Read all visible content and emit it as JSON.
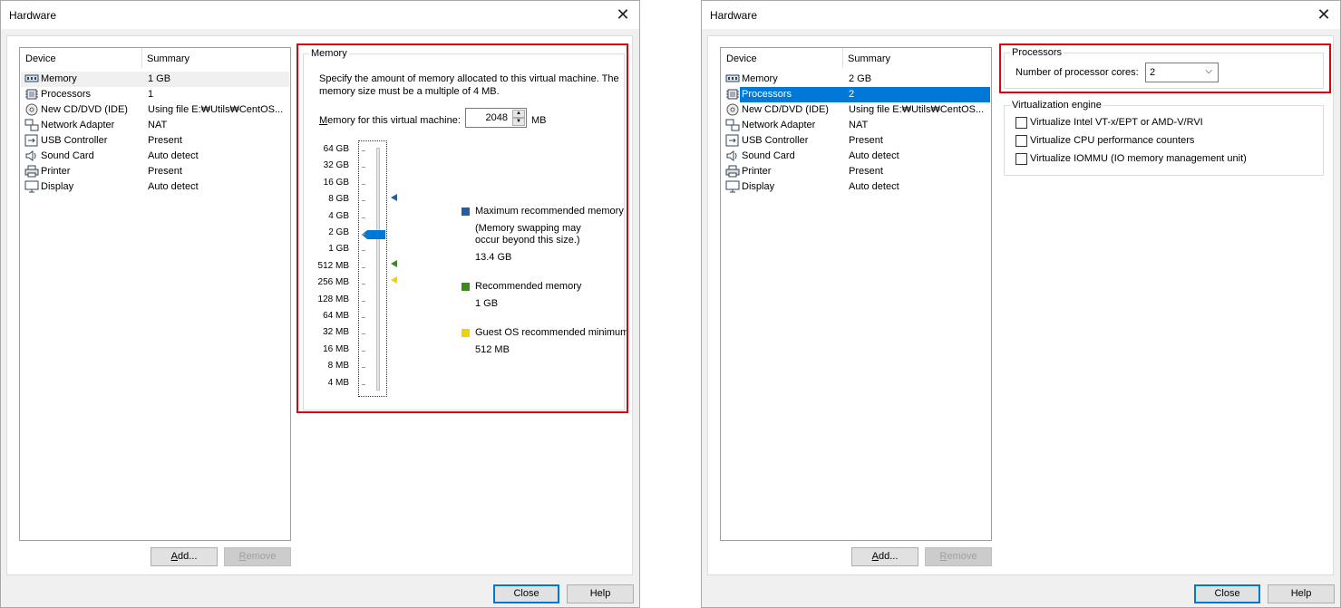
{
  "left": {
    "title": "Hardware",
    "list_headers": {
      "device": "Device",
      "summary": "Summary"
    },
    "devices": [
      {
        "name": "Memory",
        "summary": "1 GB",
        "icon": "memory-icon"
      },
      {
        "name": "Processors",
        "summary": "1",
        "icon": "processor-icon"
      },
      {
        "name": "New CD/DVD (IDE)",
        "summary": "Using file E:₩Utils₩CentOS...",
        "icon": "cd-dvd-icon"
      },
      {
        "name": "Network Adapter",
        "summary": "NAT",
        "icon": "network-adapter-icon"
      },
      {
        "name": "USB Controller",
        "summary": "Present",
        "icon": "usb-icon"
      },
      {
        "name": "Sound Card",
        "summary": "Auto detect",
        "icon": "speaker-icon"
      },
      {
        "name": "Printer",
        "summary": "Present",
        "icon": "printer-icon"
      },
      {
        "name": "Display",
        "summary": "Auto detect",
        "icon": "monitor-icon"
      }
    ],
    "buttons": {
      "add_u": "A",
      "add_rest": "dd...",
      "remove_u": "R",
      "remove_rest": "emove",
      "close": "Close",
      "help": "Help"
    },
    "memory": {
      "legend": "Memory",
      "description": "Specify the amount of memory allocated to this virtual machine. The memory size must be a multiple of 4 MB.",
      "field_label_u": "M",
      "field_label_rest": "emory for this virtual machine:",
      "value": "2048",
      "unit": "MB",
      "scale": [
        "64 GB",
        "32 GB",
        "16 GB",
        "8 GB",
        "4 GB",
        "2 GB",
        "1 GB",
        "512 MB",
        "256 MB",
        "128 MB",
        "64 MB",
        "32 MB",
        "16 MB",
        "8 MB",
        "4 MB"
      ],
      "slider_level": "2 GB",
      "max_recommended": {
        "label": "Maximum recommended memory",
        "note": "(Memory swapping may occur beyond this size.)",
        "value": "13.4 GB",
        "color": "#1f5fa8"
      },
      "recommended": {
        "label": "Recommended memory",
        "value": "1 GB",
        "color": "#3d8b1f"
      },
      "guest_min": {
        "label": "Guest OS recommended minimum",
        "value": "512 MB",
        "color": "#f5d000"
      }
    }
  },
  "right": {
    "title": "Hardware",
    "list_headers": {
      "device": "Device",
      "summary": "Summary"
    },
    "devices": [
      {
        "name": "Memory",
        "summary": "2 GB",
        "icon": "memory-icon"
      },
      {
        "name": "Processors",
        "summary": "2",
        "icon": "processor-icon"
      },
      {
        "name": "New CD/DVD (IDE)",
        "summary": "Using file E:₩Utils₩CentOS...",
        "icon": "cd-dvd-icon"
      },
      {
        "name": "Network Adapter",
        "summary": "NAT",
        "icon": "network-adapter-icon"
      },
      {
        "name": "USB Controller",
        "summary": "Present",
        "icon": "usb-icon"
      },
      {
        "name": "Sound Card",
        "summary": "Auto detect",
        "icon": "speaker-icon"
      },
      {
        "name": "Printer",
        "summary": "Present",
        "icon": "printer-icon"
      },
      {
        "name": "Display",
        "summary": "Auto detect",
        "icon": "monitor-icon"
      }
    ],
    "selected_device": "Processors",
    "buttons": {
      "add_u": "A",
      "add_rest": "dd...",
      "remove_u": "R",
      "remove_rest": "emove",
      "close": "Close",
      "help": "Help"
    },
    "processors": {
      "legend": "Processors",
      "cores_label": "Number of processor cores:",
      "cores_value": "2"
    },
    "virtualization": {
      "legend": "Virtualization engine",
      "options": [
        {
          "label": "Virtualize Intel VT-x/EPT or AMD-V/RVI",
          "checked": false
        },
        {
          "label": "Virtualize CPU performance counters",
          "checked": false
        },
        {
          "label": "Virtualize IOMMU (IO memory management unit)",
          "checked": false
        }
      ]
    }
  },
  "colors": {
    "highlight_box": "#e0000f",
    "selection": "#0078d7"
  }
}
